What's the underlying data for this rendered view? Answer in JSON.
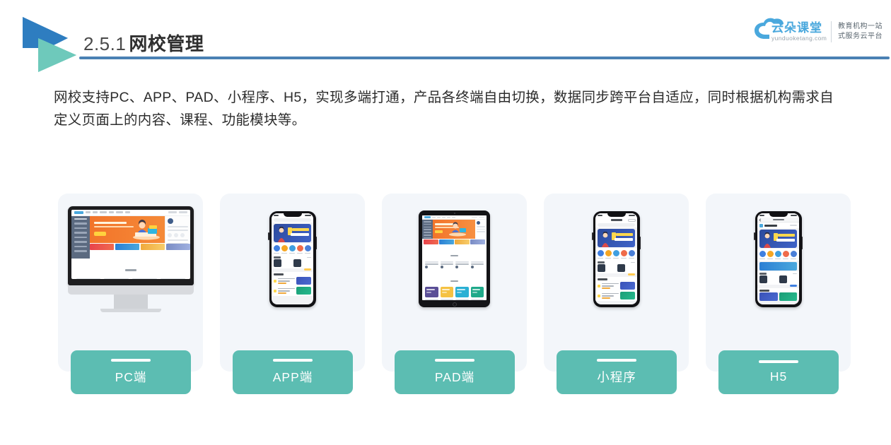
{
  "header": {
    "section_number": "2.5.1",
    "section_title": "网校管理",
    "logo_icon": "double-triangle-play-logo",
    "rule_color": "#4a81b4"
  },
  "brand": {
    "cloud_icon": "cloud-icon",
    "name_cn": "云朵课堂",
    "url": "yunduoketang.com",
    "tagline_line1": "教育机构一站",
    "tagline_line2": "式服务云平台",
    "accent_color": "#4aa8dd"
  },
  "body": {
    "paragraph": "网校支持PC、APP、PAD、小程序、H5，实现多端打通，产品各终端自由切换，数据同步跨平台自适应，同时根据机构需求自定义页面上的内容、课程、功能模块等。"
  },
  "cards": [
    {
      "id": "pc",
      "label": "PC端",
      "device": "imac-monitor"
    },
    {
      "id": "app",
      "label": "APP端",
      "device": "iphone-app"
    },
    {
      "id": "pad",
      "label": "PAD端",
      "device": "ipad-tablet"
    },
    {
      "id": "miniapp",
      "label": "小程序",
      "device": "iphone-miniprogram"
    },
    {
      "id": "h5",
      "label": "H5",
      "device": "iphone-h5-browser"
    }
  ],
  "theme": {
    "card_bg": "#f3f6fa",
    "label_bg": "#5cbdb2",
    "label_text": "#ffffff",
    "title_text": "#2f2f2f",
    "body_text": "#2c2c2c"
  }
}
